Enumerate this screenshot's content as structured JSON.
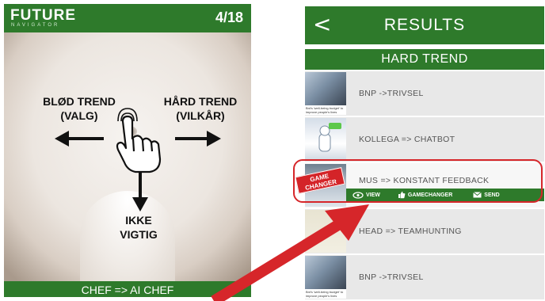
{
  "left_screen": {
    "logo_main": "FUTURE",
    "logo_sub": "NAVIGATOR",
    "counter": "4/18",
    "labels": {
      "left": "BLØD TREND\n(VALG)",
      "right": "HÅRD TREND\n(VILKÅR)",
      "down": "IKKE\nVIGTIG"
    },
    "footer": "CHEF => AI CHEF",
    "icons": [
      "hand-pointer-icon",
      "arrow-left-icon",
      "arrow-right-icon",
      "arrow-down-icon"
    ]
  },
  "right_screen": {
    "back_icon": "<",
    "title": "RESULTS",
    "subtitle": "HARD TREND",
    "rows": [
      {
        "label": "BNP ->TRIVSEL",
        "thumb_caption": "Bnt's 'well-being budget' to improve people's lives"
      },
      {
        "label": "KOLLEGA => CHATBOT",
        "thumb_caption": ""
      },
      {
        "label": "MUS => KONSTANT FEEDBACK",
        "thumb_caption": ""
      },
      {
        "label": "HEAD => TEAMHUNTING",
        "thumb_caption": ""
      },
      {
        "label": "BNP ->TRIVSEL",
        "thumb_caption": "Bnt's 'well-being budget' to improve people's lives"
      }
    ],
    "badge": "GAME\nCHANGER",
    "actions": [
      {
        "icon": "eye-icon",
        "label": "VIEW"
      },
      {
        "icon": "thumbs-up-icon",
        "label": "GAMECHANGER"
      },
      {
        "icon": "envelope-icon",
        "label": "SEND"
      }
    ]
  },
  "colors": {
    "brand_green": "#2e7a2b",
    "highlight_red": "#d6262a"
  }
}
